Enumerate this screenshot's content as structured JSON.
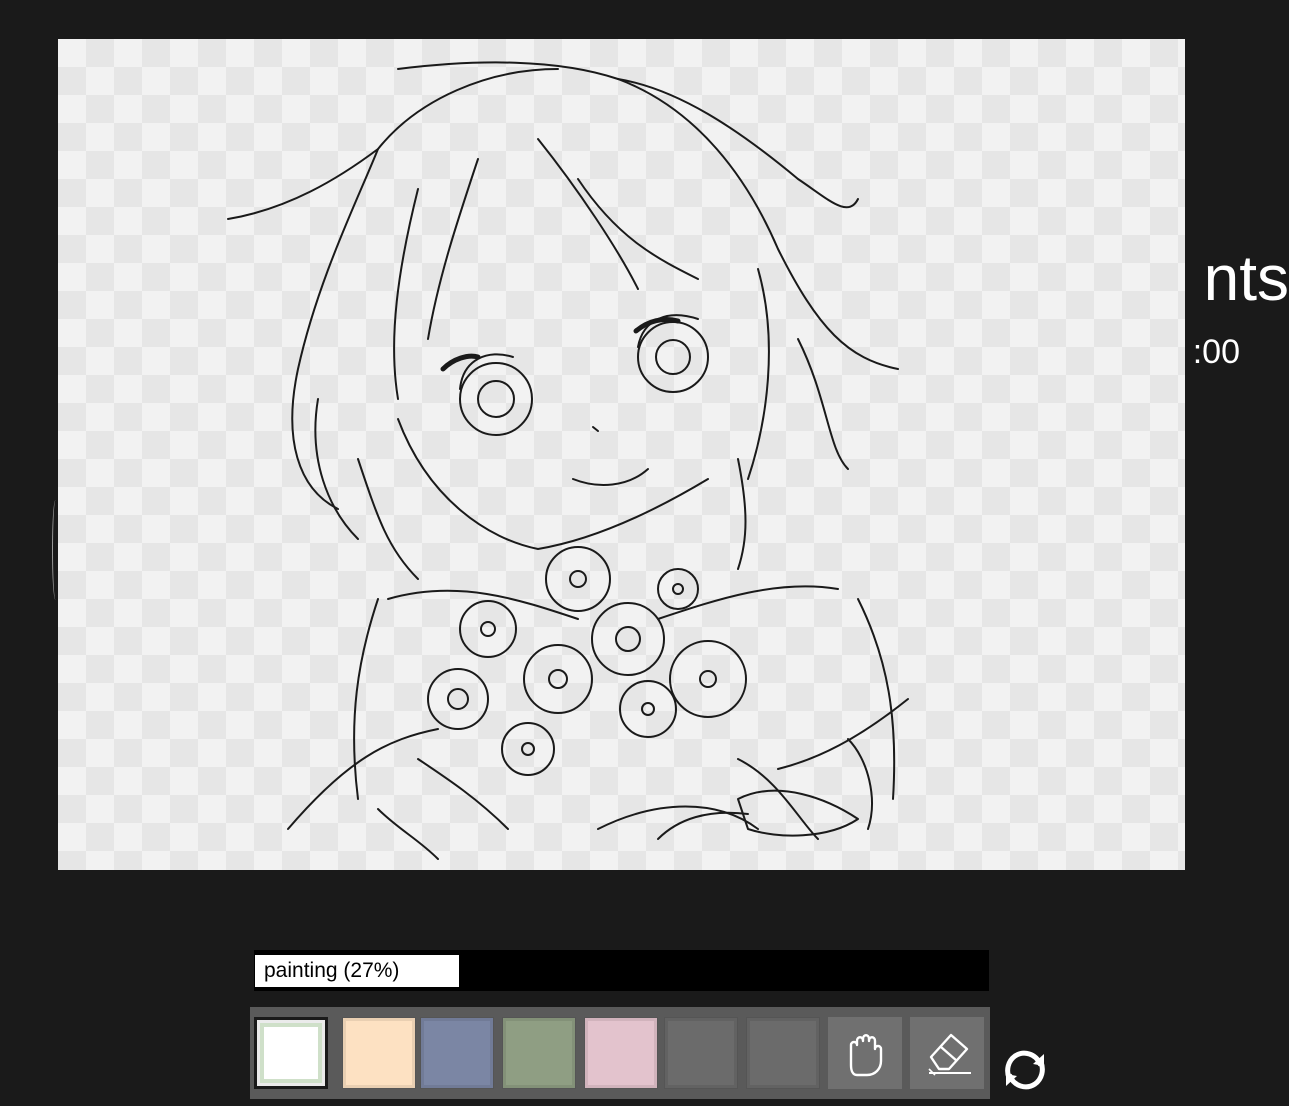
{
  "background": {
    "title_fragment": "nts",
    "subtitle_fragment": ":00"
  },
  "status": {
    "label": "painting (27%)",
    "progress_percent": 27
  },
  "palette": {
    "selected_index": 0,
    "swatches": [
      {
        "name": "white",
        "color": "#ffffff"
      },
      {
        "name": "peach",
        "color": "#fde1c2"
      },
      {
        "name": "slate-blue",
        "color": "#7b86a4"
      },
      {
        "name": "sage-green",
        "color": "#8f9e83"
      },
      {
        "name": "pink",
        "color": "#e3c3cd"
      },
      {
        "name": "empty",
        "color": "#6b6b6b"
      },
      {
        "name": "empty",
        "color": "#6b6b6b"
      }
    ],
    "tools": [
      {
        "name": "hand-icon",
        "color": "#707070"
      },
      {
        "name": "eraser-icon",
        "color": "#707070"
      }
    ]
  },
  "actions": {
    "refresh_icon": "refresh-icon"
  }
}
